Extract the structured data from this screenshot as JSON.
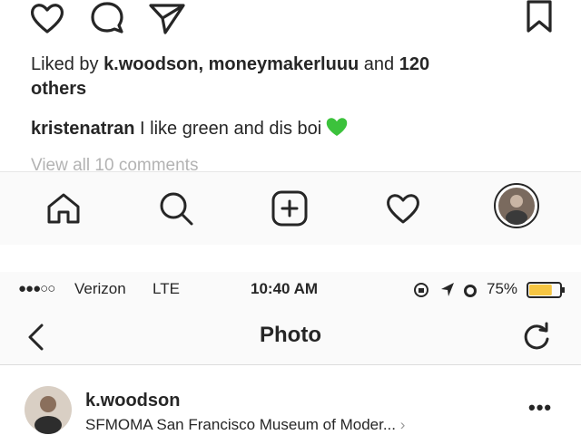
{
  "post_actions": {
    "like_icon": "heart-outline-icon",
    "comment_icon": "comment-bubble-icon",
    "share_icon": "paper-plane-icon",
    "save_icon": "bookmark-icon"
  },
  "likes": {
    "prefix": "Liked by ",
    "user1": "k.woodson",
    "sep": ", ",
    "user2": "moneymakerluuu",
    "and": " and ",
    "others_count": "120",
    "others_label": "others"
  },
  "comment": {
    "username": "kristenatran",
    "text": " I like green and dis boi",
    "emoji_color": "#3cc23c"
  },
  "view_all_comments": "View all 10 comments",
  "tab_bar": {
    "items": [
      "home-icon",
      "search-icon",
      "new-post-icon",
      "activity-heart-icon",
      "profile-avatar"
    ]
  },
  "status_bar": {
    "signal": "●●●○○",
    "carrier": "Verizon",
    "network": "LTE",
    "time": "10:40 AM",
    "battery_percent": "75%",
    "battery_level": 0.75,
    "battery_color": "#f5c542"
  },
  "nav_bar": {
    "title": "Photo",
    "back_icon": "chevron-left-icon",
    "refresh_icon": "refresh-icon"
  },
  "post_header": {
    "username": "k.woodson",
    "location": "SFMOMA San Francisco Museum of Moder...",
    "more_icon": "ellipsis-icon",
    "more_label": "•••"
  }
}
